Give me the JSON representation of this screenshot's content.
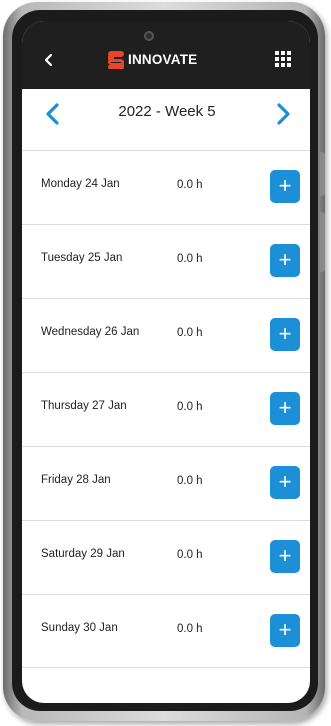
{
  "header": {
    "back_icon": "chevron-left-icon",
    "logo_text": "INNOVATE",
    "logo_color": "#e8452c",
    "menu_icon": "grid-menu-icon",
    "background": "#1f1f1f"
  },
  "week_nav": {
    "title": "2022 - Week 5",
    "prev_icon": "chevron-left-icon",
    "next_icon": "chevron-right-icon",
    "arrow_color": "#1c8fd6"
  },
  "days": [
    {
      "label": "Monday 24 Jan",
      "hours": "0.0 h",
      "add_label": "+"
    },
    {
      "label": "Tuesday 25 Jan",
      "hours": "0.0 h",
      "add_label": "+"
    },
    {
      "label": "Wednesday 26 Jan",
      "hours": "0.0 h",
      "add_label": "+"
    },
    {
      "label": "Thursday 27 Jan",
      "hours": "0.0 h",
      "add_label": "+"
    },
    {
      "label": "Friday 28 Jan",
      "hours": "0.0 h",
      "add_label": "+"
    },
    {
      "label": "Saturday 29 Jan",
      "hours": "0.0 h",
      "add_label": "+"
    },
    {
      "label": "Sunday 30 Jan",
      "hours": "0.0 h",
      "add_label": "+"
    }
  ],
  "accent_color": "#1c8fd6"
}
